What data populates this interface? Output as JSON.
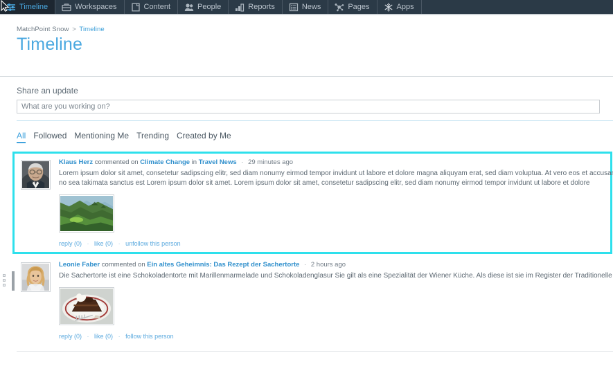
{
  "nav": {
    "items": [
      {
        "label": "Timeline",
        "icon": "timeline-icon",
        "active": true
      },
      {
        "label": "Workspaces",
        "icon": "workspaces-icon",
        "active": false
      },
      {
        "label": "Content",
        "icon": "content-icon",
        "active": false
      },
      {
        "label": "People",
        "icon": "people-icon",
        "active": false
      },
      {
        "label": "Reports",
        "icon": "reports-icon",
        "active": false
      },
      {
        "label": "News",
        "icon": "news-icon",
        "active": false
      },
      {
        "label": "Pages",
        "icon": "pages-icon",
        "active": false
      },
      {
        "label": "Apps",
        "icon": "apps-icon",
        "active": false
      }
    ]
  },
  "breadcrumb": {
    "root": "MatchPoint Snow",
    "separator": ">",
    "current": "Timeline"
  },
  "header": {
    "title": "Timeline"
  },
  "share": {
    "label": "Share an update",
    "placeholder": "What are you working on?",
    "value": ""
  },
  "filters": {
    "items": [
      {
        "label": "All",
        "active": true
      },
      {
        "label": "Followed",
        "active": false
      },
      {
        "label": "Mentioning Me",
        "active": false
      },
      {
        "label": "Trending",
        "active": false
      },
      {
        "label": "Created by Me",
        "active": false
      }
    ]
  },
  "feed": {
    "posts": [
      {
        "highlighted": true,
        "author": "Klaus Herz",
        "action": "commented on",
        "target": "Climate Change",
        "in_word": "in",
        "location": "Travel News",
        "separator": "·",
        "time": "29 minutes ago",
        "text": "Lorem ipsum dolor sit amet, consetetur sadipscing elitr, sed diam nonumy eirmod tempor invidunt ut labore et dolore magna aliquyam erat, sed diam voluptua. At vero eos et accusam et gubergren, no sea takimata sanctus est Lorem ipsum dolor sit amet. Lorem ipsum dolor sit amet, consetetur sadipscing elitr, sed diam nonumy eirmod tempor invidunt ut labore et dolore",
        "thumbnail": "rice-terraces-photo",
        "avatar": "avatar-klaus-herz",
        "actions": {
          "reply": "reply (0)",
          "like": "like (0)",
          "follow": "unfollow this person",
          "dot": "·"
        }
      },
      {
        "highlighted": false,
        "author": "Leonie Faber",
        "action": "commented on",
        "target": "Ein altes Geheimnis: Das Rezept der Sachertorte",
        "in_word": "",
        "location": "",
        "separator": "·",
        "time": "2 hours ago",
        "text": "Die Sachertorte ist eine Schokoladentorte mit Marillenmarmelade und Schokoladenglasur Sie gilt als eine Spezialität der Wiener Küche. Als diese ist sie im Register der Traditionellen Lebe",
        "thumbnail": "sachertorte-photo",
        "avatar": "avatar-leonie-faber",
        "actions": {
          "reply": "reply (0)",
          "like": "like (0)",
          "follow": "follow this person",
          "dot": "·"
        }
      }
    ]
  },
  "colors": {
    "nav_background": "#2b3a47",
    "nav_active_background": "#1d2731",
    "accent_blue": "#4aa8e0",
    "link_blue": "#2f8fcc",
    "highlight_cyan": "#2ee0ec",
    "text_gray": "#5c6872"
  }
}
